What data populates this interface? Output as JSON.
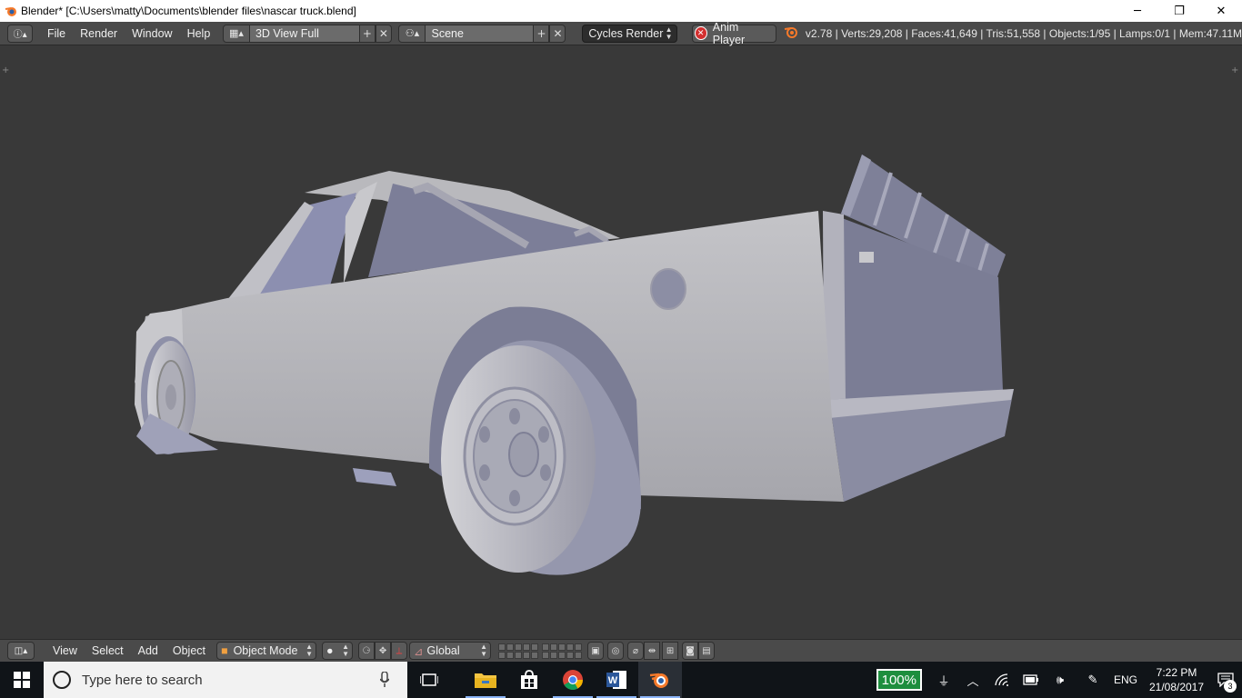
{
  "window": {
    "title": "Blender* [C:\\Users\\matty\\Documents\\blender files\\nascar truck.blend]",
    "minimize_glyph": "─",
    "restore_glyph": "❐",
    "close_glyph": "✕"
  },
  "infobar": {
    "menus": [
      "File",
      "Render",
      "Window",
      "Help"
    ],
    "screen_layout": "3D View Full",
    "scene": "Scene",
    "render_engine": "Cycles Render",
    "anim_player": "Anim Player",
    "stats": "v2.78 | Verts:29,208 | Faces:41,649 | Tris:51,558 | Objects:1/95 | Lamps:0/1 | Mem:47.11M"
  },
  "viewheader": {
    "menus": [
      "View",
      "Select",
      "Add",
      "Object"
    ],
    "mode": "Object Mode",
    "transform_orientation": "Global"
  },
  "taskbar": {
    "search_placeholder": "Type here to search",
    "battery": "100%",
    "language": "ENG",
    "time": "7:22 PM",
    "date": "21/08/2017",
    "notifications": "3",
    "pinned_apps": [
      "file-explorer-icon",
      "store-icon",
      "chrome-icon",
      "word-icon",
      "blender-icon"
    ]
  },
  "colors": {
    "viewport_bg": "#393939",
    "header_bg": "#4a4a4a",
    "model_light": "#b4b4b8",
    "model_shadow": "#7a7c94",
    "taskbar_bg": "#101418",
    "battery_green": "#1e8e3e"
  }
}
